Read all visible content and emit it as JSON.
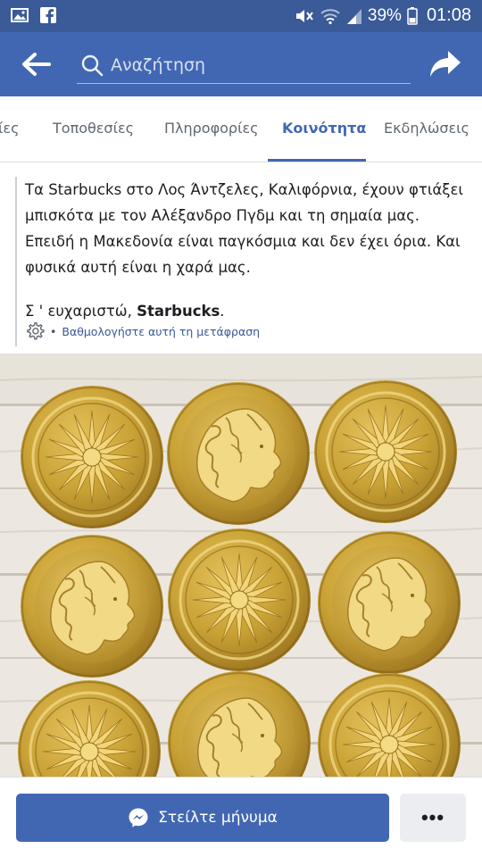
{
  "status_bar": {
    "battery_percent": "39%",
    "time": "01:08",
    "icons": [
      "gallery-icon",
      "facebook-icon",
      "mute-icon",
      "wifi-icon",
      "signal-icon",
      "battery-icon"
    ]
  },
  "header": {
    "search_placeholder": "Αναζήτηση",
    "icons": [
      "back-arrow-icon",
      "search-icon",
      "share-icon"
    ],
    "background": "#4267b2"
  },
  "tabs": [
    {
      "label": "ίες",
      "active": false
    },
    {
      "label": "Τοποθεσίες",
      "active": false
    },
    {
      "label": "Πληροφορίες",
      "active": false
    },
    {
      "label": "Κοινότητα",
      "active": true
    },
    {
      "label": "Εκδηλώσεις",
      "active": false
    }
  ],
  "post": {
    "paragraph1": "Τα Starbucks στο Λος Άντζελες, Καλιφόρνια, έχουν φτιάξει μπισκότα με τον Αλέξανδρο Πγδμ και τη σημαία μας. Επειδή η Μακεδονία είναι παγκόσμια και δεν έχει όρια. Και φυσικά αυτή είναι η χαρά μας.",
    "thanks_prefix": "Σ ' ευχαριστώ, ",
    "thanks_name": "Starbucks",
    "thanks_suffix": ".",
    "rate_separator": "•",
    "rate_link": "Βαθμολογήστε αυτή τη μετάφραση"
  },
  "photo": {
    "subject": "golden cookies with sun emblem and profile head on white wooden boards"
  },
  "bottom_bar": {
    "message_button": "Στείλτε μήνυμα",
    "more_button": "•••"
  },
  "colors": {
    "brand_blue": "#4267b2",
    "status_bar": "#3a5a98",
    "cookie_gold": "#c9a235"
  }
}
